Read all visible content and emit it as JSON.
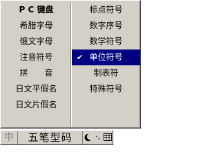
{
  "menu": {
    "left_items": [
      {
        "label": "P C 键盘"
      },
      {
        "label": "希腊字母"
      },
      {
        "label": "俄文字母"
      },
      {
        "label": "注音符号"
      },
      {
        "label": "拼　　音"
      },
      {
        "label": "日文平假名"
      },
      {
        "label": "日文片假名"
      }
    ],
    "right_items": [
      {
        "label": "标点符号"
      },
      {
        "label": "数字序号"
      },
      {
        "label": "数学符号"
      },
      {
        "label": "单位符号",
        "checked": true,
        "selected": true
      },
      {
        "label": "制表符"
      },
      {
        "label": "特殊符号"
      }
    ],
    "check_glyph": "✔"
  },
  "status_bar": {
    "lang_label": "中",
    "mode_label": "五笔型码",
    "width_icon": "half-moon-icon",
    "punct_label": "·,",
    "keyboard_icon": "soft-keyboard-icon"
  },
  "colors": {
    "face": "#d4d0c8",
    "highlight": "#000080",
    "highlight_text": "#ffffff"
  }
}
